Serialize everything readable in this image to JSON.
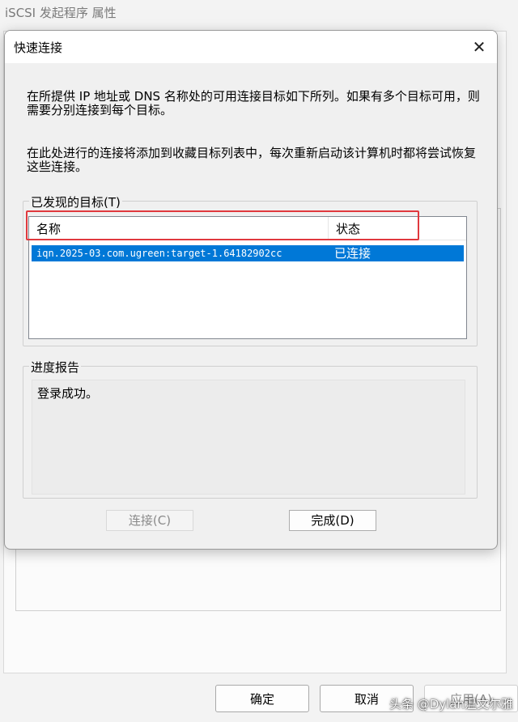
{
  "parent": {
    "title": "iSCSI 发起程序 属性",
    "ok_label": "确定",
    "cancel_label": "取消",
    "apply_label": "应用(A)"
  },
  "watermark": "头条 @Dylan温文尔雅",
  "dialog": {
    "title": "快速连接",
    "close_glyph": "✕",
    "description_1": "在所提供 IP 地址或 DNS 名称处的可用连接目标如下所列。如果有多个目标可用，则需要分别连接到每个目标。",
    "description_2": "在此处进行的连接将添加到收藏目标列表中，每次重新启动该计算机时都将尝试恢复这些连接。",
    "targets_group_label": "已发现的目标(T)",
    "list": {
      "columns": [
        "名称",
        "状态"
      ],
      "rows": [
        {
          "name": "iqn.2025-03.com.ugreen:target-1.64182902cc",
          "status": "已连接",
          "selected": true
        }
      ]
    },
    "progress_group_label": "进度报告",
    "progress_text": "登录成功。",
    "connect_label": "连接(C)",
    "done_label": "完成(D)"
  },
  "colors": {
    "selection": "#0078d7",
    "highlight_box": "#e0393e"
  }
}
